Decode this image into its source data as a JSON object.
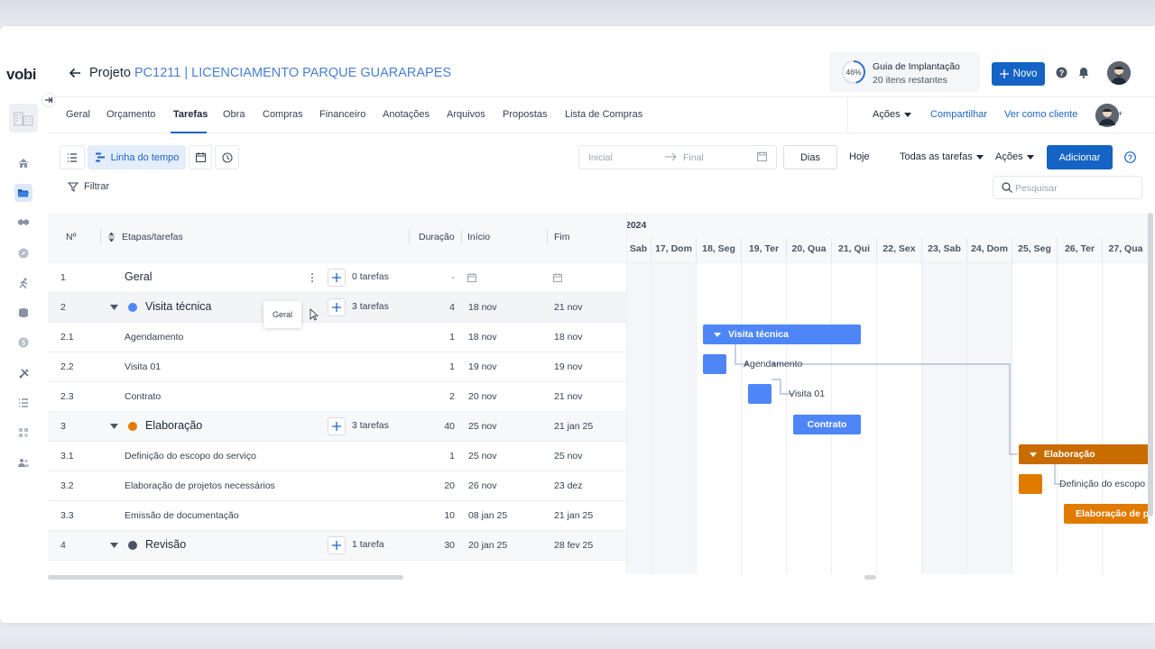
{
  "app": {
    "logo": "vobi"
  },
  "header": {
    "title_prefix": "Projeto ",
    "project_code": "PC1211 | LICENCIAMENTO PARQUE GUARARAPES",
    "guide": {
      "percent": "46%",
      "progress": 0.46,
      "title": "Guia de Implantação",
      "subtitle": "20 itens restantes"
    },
    "new_button": "Novo"
  },
  "sidebar": {
    "icons": [
      "home-icon",
      "folder-icon",
      "handshake-icon",
      "compass-icon",
      "running-icon",
      "coins-icon",
      "dollar-icon",
      "tools-icon",
      "list-icon",
      "grid-plus-icon",
      "users-icon"
    ],
    "active": "folder-icon"
  },
  "tabs": [
    "Geral",
    "Orçamento",
    "Tarefas",
    "Obra",
    "Compras",
    "Financeiro",
    "Anotações",
    "Arquivos",
    "Propostas",
    "Lista de Compras"
  ],
  "active_tab": "Tarefas",
  "tab_actions": {
    "acoes": "Ações",
    "share": "Compartilhar",
    "view_as_client": "Ver como cliente",
    "plus": "+"
  },
  "toolbar": {
    "timeline_label": "Linha do tempo",
    "date_from_placeholder": "Inicial",
    "date_to_placeholder": "Final",
    "days": "Dias",
    "today": "Hoje",
    "all_tasks": "Todas as tarefas",
    "actions": "Ações",
    "add": "Adicionar",
    "filter": "Filtrar",
    "search_placeholder": "Pesquisar"
  },
  "grid": {
    "headers": {
      "num": "Nº",
      "name": "Etapas/tarefas",
      "duration": "Duração",
      "start": "Início",
      "end": "Fim"
    },
    "rows": [
      {
        "num": "1",
        "name": "Geral",
        "type": "group",
        "count": "0 tarefas",
        "duration": "-",
        "start": "",
        "end": ""
      },
      {
        "num": "2",
        "name": "Visita técnica",
        "type": "stage",
        "color": "#4f86f7",
        "count": "3 tarefas",
        "duration": "4",
        "start": "18 nov",
        "end": "21 nov"
      },
      {
        "num": "2.1",
        "name": "Agendamento",
        "type": "task",
        "duration": "1",
        "start": "18 nov",
        "end": "18 nov"
      },
      {
        "num": "2.2",
        "name": "Visita 01",
        "type": "task",
        "duration": "1",
        "start": "19 nov",
        "end": "19 nov"
      },
      {
        "num": "2.3",
        "name": "Contrato",
        "type": "task",
        "duration": "2",
        "start": "20 nov",
        "end": "21 nov"
      },
      {
        "num": "3",
        "name": "Elaboração",
        "type": "stage",
        "color": "#e07b00",
        "count": "3 tarefas",
        "duration": "40",
        "start": "25 nov",
        "end": "21 jan 25"
      },
      {
        "num": "3.1",
        "name": "Definição do escopo do serviço",
        "type": "task",
        "duration": "1",
        "start": "25 nov",
        "end": "25 nov"
      },
      {
        "num": "3.2",
        "name": "Elaboração de projetos necessários",
        "type": "task",
        "duration": "20",
        "start": "26 nov",
        "end": "23 dez"
      },
      {
        "num": "3.3",
        "name": "Emissão de documentação",
        "type": "task",
        "duration": "10",
        "start": "08 jan 25",
        "end": "21 jan 25"
      },
      {
        "num": "4",
        "name": "Revisão",
        "type": "stage",
        "color": "#4b5563",
        "count": "1 tarefa",
        "duration": "30",
        "start": "20 jan 25",
        "end": "28 fev 25"
      }
    ],
    "tooltip": "Geral"
  },
  "gantt": {
    "year_label": "2024",
    "days": [
      "Sab",
      "17, Dom",
      "18, Seg",
      "19, Ter",
      "20, Qua",
      "21, Qui",
      "22, Sex",
      "23, Sab",
      "24, Dom",
      "25, Seg",
      "26, Ter",
      "27, Qua"
    ],
    "bars": {
      "visita": "Visita técnica",
      "agendamento": "Agendamento",
      "visita01": "Visita 01",
      "contrato": "Contrato",
      "elaboracao": "Elaboração",
      "definicao": "Definição do escopo",
      "elab_proj": "Elaboração de pr"
    },
    "colors": {
      "blue": "#4f86f7",
      "orange": "#e07b00",
      "dark_orange": "#c96c00"
    }
  }
}
